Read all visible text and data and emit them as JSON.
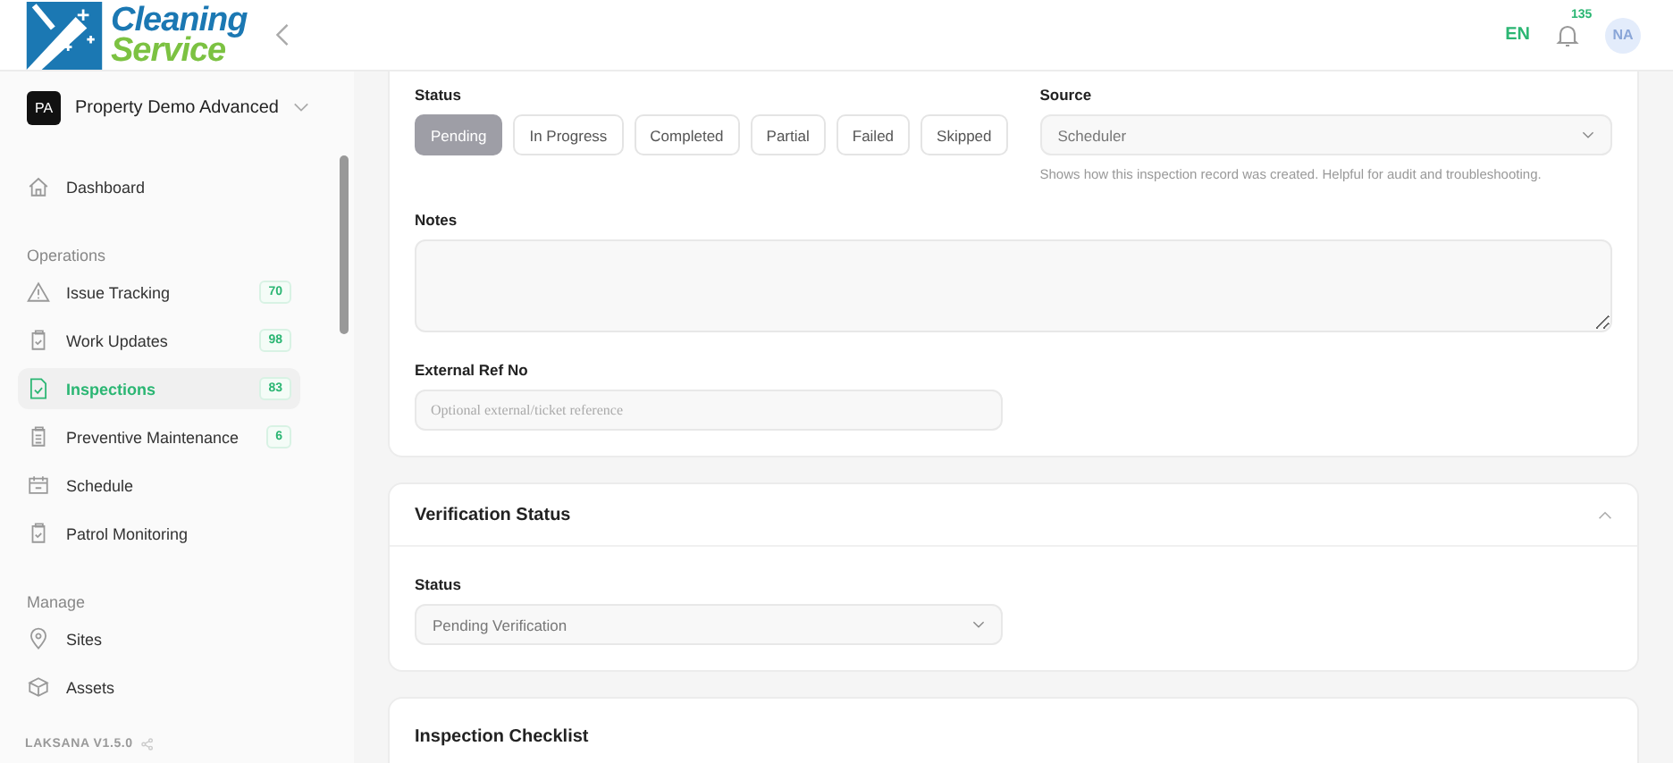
{
  "header": {
    "logo_line_1": "Cleaning",
    "logo_line_2": "Service",
    "language": "EN",
    "notification_count": "135",
    "avatar": "NA"
  },
  "sidebar": {
    "property": {
      "initials": "PA",
      "name": "Property Demo Advanced"
    },
    "sections": [
      {
        "items": [
          {
            "kind": "home",
            "label": "Dashboard",
            "selected": false
          }
        ]
      },
      {
        "title": "Operations",
        "items": [
          {
            "kind": "alert",
            "label": "Issue Tracking",
            "count": "70",
            "selected": false
          },
          {
            "kind": "clipboard",
            "label": "Work Updates",
            "count": "98",
            "selected": false
          },
          {
            "kind": "document",
            "label": "Inspections",
            "count": "83",
            "selected": true
          },
          {
            "kind": "list",
            "label": "Preventive Maintenance",
            "count": "6",
            "selected": false
          },
          {
            "kind": "calendar",
            "label": "Schedule",
            "selected": false
          },
          {
            "kind": "clipboard",
            "label": "Patrol Monitoring",
            "selected": false
          }
        ]
      },
      {
        "title": "Manage",
        "items": [
          {
            "kind": "pin",
            "label": "Sites",
            "selected": false
          },
          {
            "kind": "box",
            "label": "Assets",
            "selected": false
          }
        ]
      }
    ],
    "version": "LAKSANA V1.5.0"
  },
  "details": {
    "status_label": "Status",
    "status_options": [
      {
        "label": "Pending",
        "selected": true
      },
      {
        "label": "In Progress",
        "selected": false
      },
      {
        "label": "Completed",
        "selected": false
      },
      {
        "label": "Partial",
        "selected": false
      },
      {
        "label": "Failed",
        "selected": false
      },
      {
        "label": "Skipped",
        "selected": false
      }
    ],
    "source_label": "Source",
    "source_value": "Scheduler",
    "source_help": "Shows how this inspection record was created. Helpful for audit and troubleshooting.",
    "notes_label": "Notes",
    "external_ref_label": "External Ref No",
    "external_ref_placeholder": "Optional external/ticket reference"
  },
  "verification": {
    "title": "Verification Status",
    "expanded": true,
    "status_label": "Status",
    "status_value": "Pending Verification"
  },
  "checklist": {
    "title": "Inspection Checklist"
  }
}
